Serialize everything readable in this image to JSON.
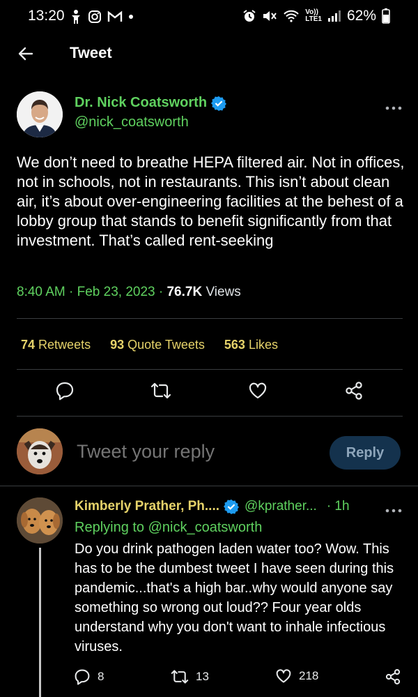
{
  "status_bar": {
    "time": "13:20",
    "volte_top": "Vo))",
    "volte_bottom": "LTE1",
    "battery": "62%"
  },
  "header": {
    "title": "Tweet"
  },
  "tweet": {
    "author_name": "Dr. Nick Coatsworth",
    "handle": "@nick_coatsworth",
    "text": "We don’t need to breathe HEPA filtered air.  Not in offices, not in schools, not in restaurants. This isn’t about clean air, it’s about over-engineering facilities at the behest of a lobby group that stands to benefit significantly from that investment. That’s called rent-seeking",
    "time": "8:40 AM",
    "date": "Feb 23, 2023",
    "views_count": "76.7K",
    "views_label": "Views",
    "retweets_count": "74",
    "retweets_label": "Retweets",
    "quotes_count": "93",
    "quotes_label": "Quote Tweets",
    "likes_count": "563",
    "likes_label": "Likes"
  },
  "composer": {
    "placeholder": "Tweet your reply",
    "reply_button": "Reply"
  },
  "reply": {
    "author_name": "Kimberly Prather, Ph....",
    "handle": "@kprather...",
    "time": "1h",
    "replying_to_label": "Replying to",
    "replying_to_handle": "@nick_coatsworth",
    "text": "Do you drink pathogen laden water too? Wow. This has to be the dumbest tweet I have seen during this pandemic...that's a high bar..why would anyone say something so wrong out loud?? Four year olds understand why you don't want to inhale infectious viruses.",
    "reply_count": "8",
    "retweet_count": "13",
    "like_count": "218"
  },
  "colors": {
    "background": "#000000",
    "name_green": "#5fd15f",
    "stat_yellow": "#e6d36a",
    "verified_blue": "#1d9bf0"
  }
}
